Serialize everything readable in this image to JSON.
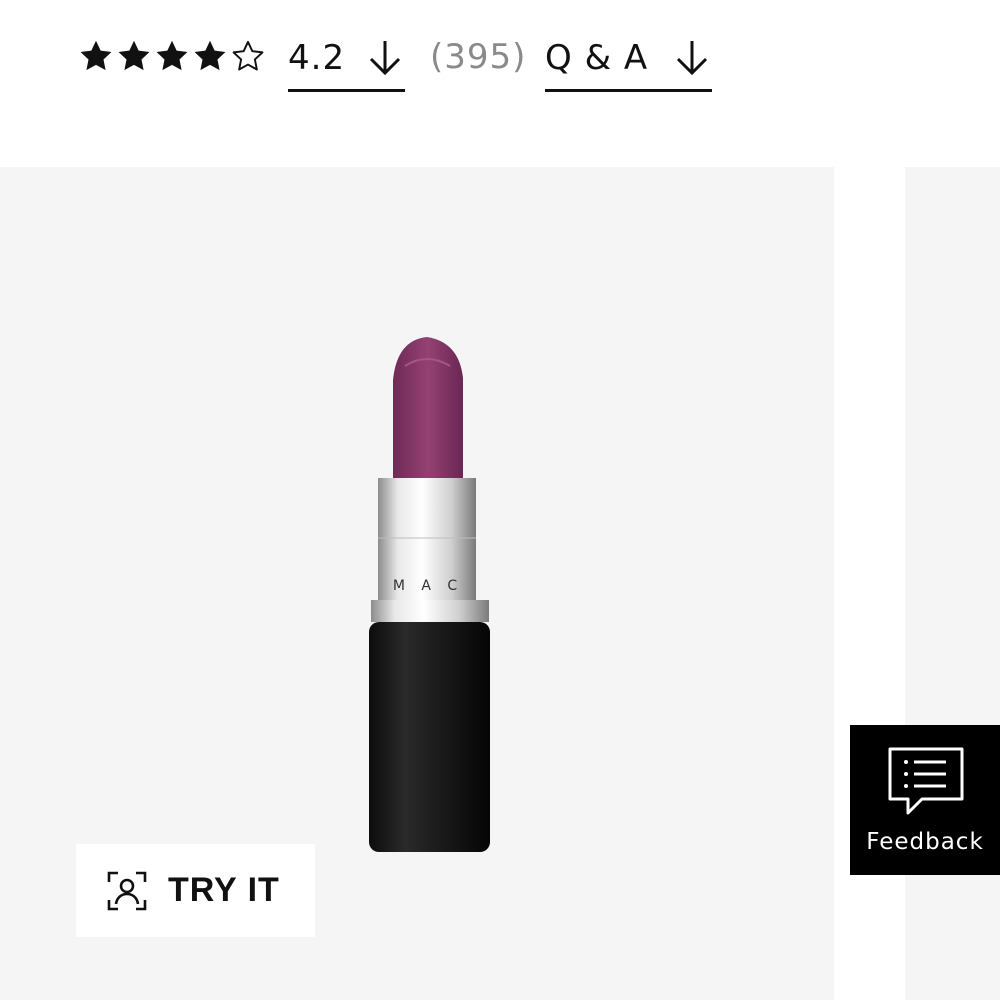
{
  "rating": {
    "stars_filled": 4,
    "stars_total": 5,
    "value": "4.2",
    "review_count": "(395)",
    "qa_label": "Q & A"
  },
  "product": {
    "brand": "MAC",
    "lipstick_color": "#8b3a6e"
  },
  "try_it": {
    "label": "TRY IT"
  },
  "feedback": {
    "label": "Feedback"
  },
  "colors": {
    "text": "#111111",
    "muted": "#8a8a8a",
    "gallery_bg": "#f5f5f5",
    "feedback_bg": "#000000"
  },
  "icons": [
    "star-filled-icon",
    "star-outline-icon",
    "arrow-down-icon",
    "face-scan-icon",
    "chat-bubble-icon"
  ]
}
